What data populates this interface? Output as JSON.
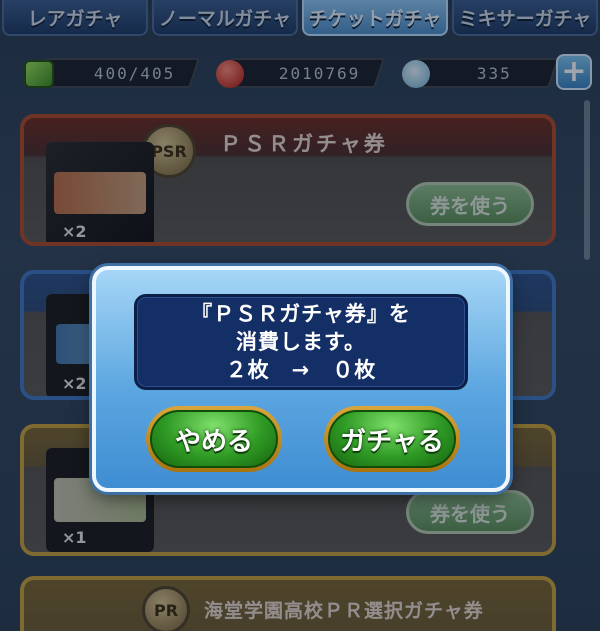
{
  "tabs": [
    {
      "label": "レアガチャ",
      "active": false
    },
    {
      "label": "ノーマルガチャ",
      "active": false
    },
    {
      "label": "チケットガチャ",
      "active": true
    },
    {
      "label": "ミキサーガチャ",
      "active": false
    }
  ],
  "resources": {
    "stamina": "400/405",
    "coins": "2010769",
    "gems": "335",
    "plus_label": "+"
  },
  "cards": [
    {
      "title": "ＰＳＲガチャ券",
      "badge": "PSR",
      "count": "×2",
      "button": "券を使う"
    },
    {
      "title": "",
      "badge": "",
      "count": "×2",
      "button": ""
    },
    {
      "title": "",
      "badge": "",
      "count": "×1",
      "button": "券を使う"
    },
    {
      "title": "海堂学園高校ＰＲ選択ガチャ券",
      "badge": "PR",
      "count": "",
      "button": ""
    }
  ],
  "dialog": {
    "line1": "『ＰＳＲガチャ券』を",
    "line2": "消費します。",
    "line3": "２枚　→　０枚",
    "cancel_label": "やめる",
    "confirm_label": "ガチャる"
  },
  "colors": {
    "accent_blue": "#5ca6e0",
    "message_bg": "#142e66",
    "button_green": "#2f9a25",
    "button_rim": "#d8a63a"
  }
}
